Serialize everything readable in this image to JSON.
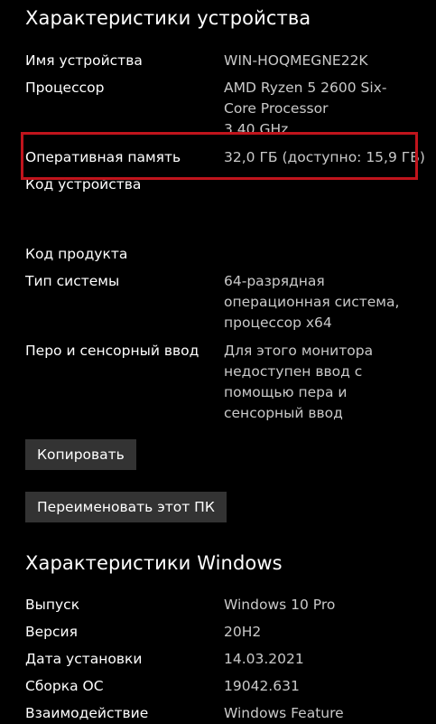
{
  "device_section": {
    "title": "Характеристики устройства",
    "rows": [
      {
        "label": "Имя устройства",
        "value_lines": [
          "WIN-HOQMEGNE22K"
        ]
      },
      {
        "label": "Процессор",
        "value_lines": [
          "AMD Ryzen 5 2600 Six-",
          "Core Processor",
          "3.40 GHz"
        ]
      },
      {
        "label": "Оперативная память",
        "value_lines": [
          "32,0 ГБ (доступно: 15,9 ГБ)"
        ]
      },
      {
        "label": "Код устройства",
        "value_lines": []
      },
      {
        "label": "Код продукта",
        "value_lines": []
      },
      {
        "label": "Тип системы",
        "value_lines": [
          "64-разрядная",
          "операционная система,",
          "процессор x64"
        ]
      },
      {
        "label": "Перо и сенсорный ввод",
        "value_lines": [
          "Для этого монитора",
          "недоступен ввод с",
          "помощью пера и",
          "сенсорный ввод"
        ]
      }
    ],
    "copy_button": "Копировать",
    "rename_button": "Переименовать этот ПК"
  },
  "windows_section": {
    "title": "Характеристики Windows",
    "rows": [
      {
        "label": "Выпуск",
        "value": "Windows 10 Pro"
      },
      {
        "label": "Версия",
        "value": "20H2"
      },
      {
        "label": "Дата установки",
        "value": "14.03.2021"
      },
      {
        "label": "Сборка ОС",
        "value": "19042.631"
      },
      {
        "label": "Взаимодействие",
        "value": "Windows Feature"
      }
    ]
  },
  "colors": {
    "background": "#000000",
    "highlight": "#c0141c",
    "button": "#333333",
    "value_text": "#c9c9c9"
  }
}
